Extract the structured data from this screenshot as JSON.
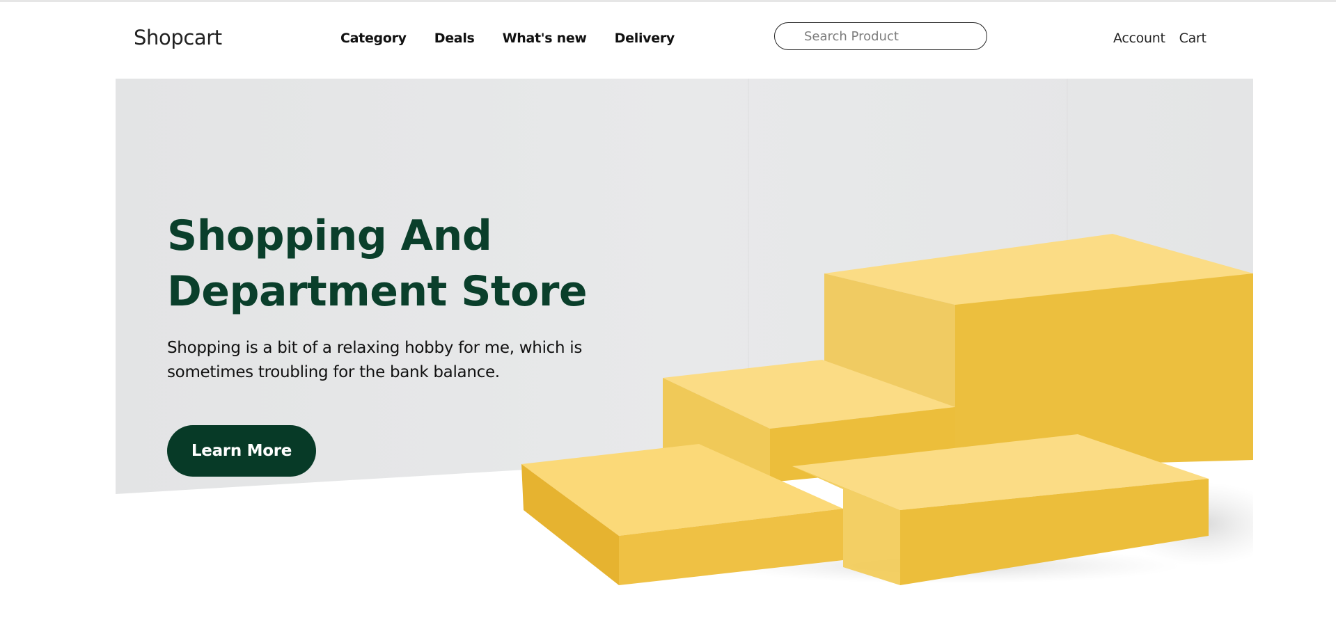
{
  "header": {
    "logo": "Shopcart",
    "nav": [
      "Category",
      "Deals",
      "What's new",
      "Delivery"
    ],
    "search_placeholder": "Search Product",
    "account_label": "Account",
    "cart_label": "Cart"
  },
  "hero": {
    "title_line1": "Shopping And",
    "title_line2": "Department Store",
    "description_line1": "Shopping is a bit of a relaxing hobby for me, which is",
    "description_line2": "sometimes troubling for the bank balance.",
    "cta_label": "Learn More"
  },
  "colors": {
    "brand_dark_green": "#073a27",
    "title_green": "#0a3f2b",
    "block_yellow": "#f3c74a",
    "hero_bg_gray": "#e4e5e6"
  }
}
